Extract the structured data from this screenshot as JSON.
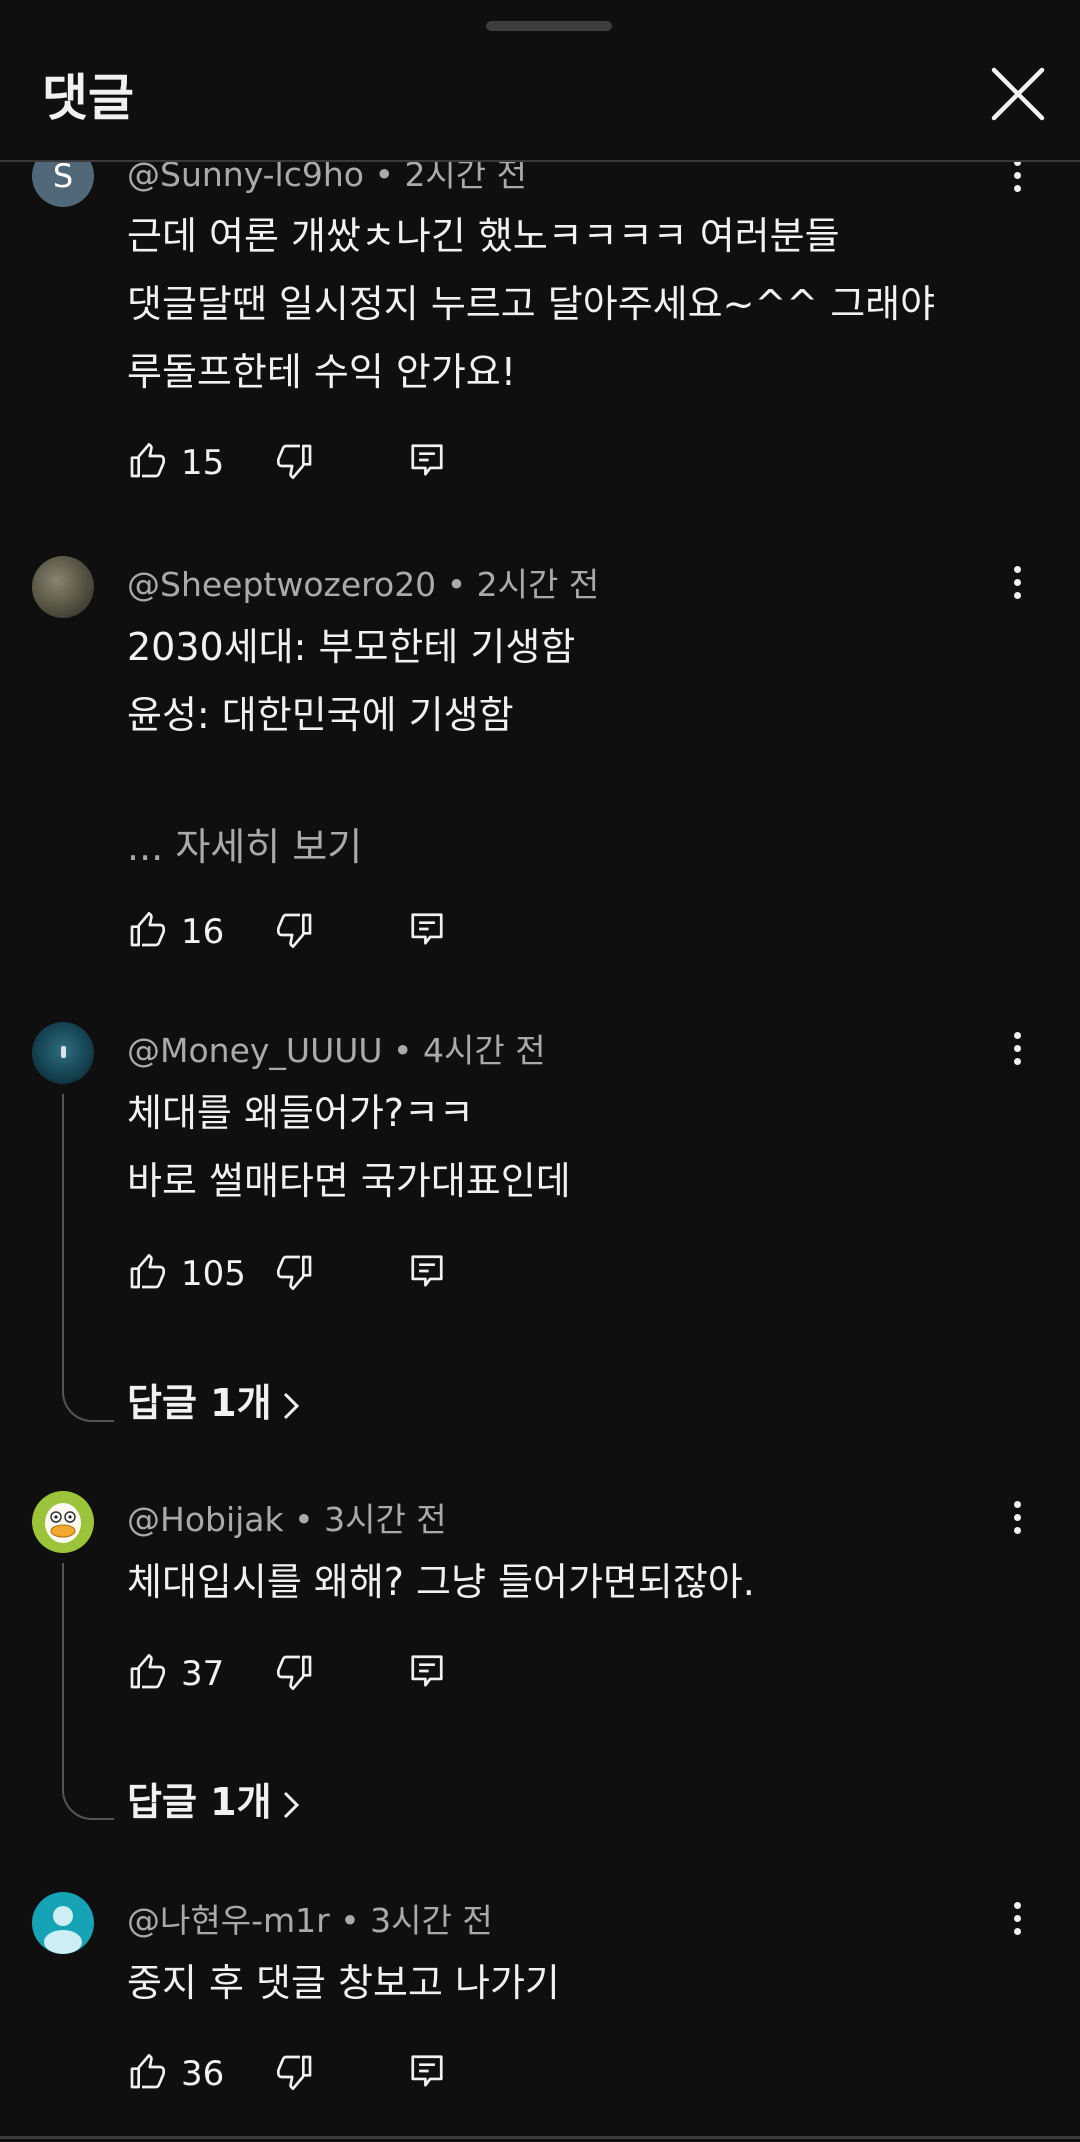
{
  "header": {
    "title": "댓글"
  },
  "comments": [
    {
      "author": "@Sunny-lc9ho",
      "time": "2시간 전",
      "avatar_letter": "S",
      "lines": [
        "근데 여론 개쌌ㅊ나긴 했노ㅋㅋㅋㅋ 여러분들",
        "댓글달땐 일시정지 누르고 달아주세요~^^ 그래야",
        "루돌프한테 수익 안가요!"
      ],
      "likes": "15"
    },
    {
      "author": "@Sheeptwozero20",
      "time": "2시간 전",
      "lines": [
        "2030세대: 부모한테 기생함",
        "윤성: 대한민국에 기생함"
      ],
      "read_more": "... 자세히 보기",
      "likes": "16"
    },
    {
      "author": "@Money_UUUU",
      "time": "4시간 전",
      "lines": [
        "체대를 왜들어가?ㅋㅋ",
        "바로 썰매타면 국가대표인데"
      ],
      "likes": "105",
      "replies": "답글 1개"
    },
    {
      "author": "@Hobijak",
      "time": "3시간 전",
      "lines": [
        "체대입시를 왜해? 그냥 들어가면되잖아."
      ],
      "likes": "37",
      "replies": "답글 1개"
    },
    {
      "author": "@나현우-m1r",
      "time": "3시간 전",
      "lines": [
        "중지 후 댓글 창보고  나가기"
      ],
      "likes": "36"
    }
  ],
  "separator": "•",
  "colors": {
    "background": "#0f0f0f",
    "text": "#f1f1f1",
    "secondary": "#aaaaaa",
    "divider": "#3a3a3a"
  },
  "icons": [
    "close-icon",
    "more-vert-icon",
    "thumb-up-icon",
    "thumb-down-icon",
    "reply-icon",
    "chevron-right-icon",
    "default-avatar-icon"
  ]
}
